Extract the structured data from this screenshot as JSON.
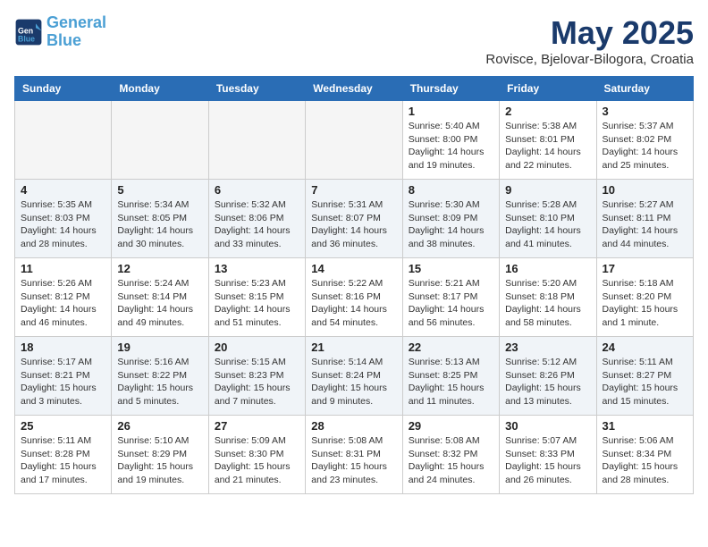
{
  "header": {
    "logo_line1": "General",
    "logo_line2": "Blue",
    "month": "May 2025",
    "location": "Rovisce, Bjelovar-Bilogora, Croatia"
  },
  "weekdays": [
    "Sunday",
    "Monday",
    "Tuesday",
    "Wednesday",
    "Thursday",
    "Friday",
    "Saturday"
  ],
  "weeks": [
    [
      {
        "day": "",
        "detail": ""
      },
      {
        "day": "",
        "detail": ""
      },
      {
        "day": "",
        "detail": ""
      },
      {
        "day": "",
        "detail": ""
      },
      {
        "day": "1",
        "detail": "Sunrise: 5:40 AM\nSunset: 8:00 PM\nDaylight: 14 hours\nand 19 minutes."
      },
      {
        "day": "2",
        "detail": "Sunrise: 5:38 AM\nSunset: 8:01 PM\nDaylight: 14 hours\nand 22 minutes."
      },
      {
        "day": "3",
        "detail": "Sunrise: 5:37 AM\nSunset: 8:02 PM\nDaylight: 14 hours\nand 25 minutes."
      }
    ],
    [
      {
        "day": "4",
        "detail": "Sunrise: 5:35 AM\nSunset: 8:03 PM\nDaylight: 14 hours\nand 28 minutes."
      },
      {
        "day": "5",
        "detail": "Sunrise: 5:34 AM\nSunset: 8:05 PM\nDaylight: 14 hours\nand 30 minutes."
      },
      {
        "day": "6",
        "detail": "Sunrise: 5:32 AM\nSunset: 8:06 PM\nDaylight: 14 hours\nand 33 minutes."
      },
      {
        "day": "7",
        "detail": "Sunrise: 5:31 AM\nSunset: 8:07 PM\nDaylight: 14 hours\nand 36 minutes."
      },
      {
        "day": "8",
        "detail": "Sunrise: 5:30 AM\nSunset: 8:09 PM\nDaylight: 14 hours\nand 38 minutes."
      },
      {
        "day": "9",
        "detail": "Sunrise: 5:28 AM\nSunset: 8:10 PM\nDaylight: 14 hours\nand 41 minutes."
      },
      {
        "day": "10",
        "detail": "Sunrise: 5:27 AM\nSunset: 8:11 PM\nDaylight: 14 hours\nand 44 minutes."
      }
    ],
    [
      {
        "day": "11",
        "detail": "Sunrise: 5:26 AM\nSunset: 8:12 PM\nDaylight: 14 hours\nand 46 minutes."
      },
      {
        "day": "12",
        "detail": "Sunrise: 5:24 AM\nSunset: 8:14 PM\nDaylight: 14 hours\nand 49 minutes."
      },
      {
        "day": "13",
        "detail": "Sunrise: 5:23 AM\nSunset: 8:15 PM\nDaylight: 14 hours\nand 51 minutes."
      },
      {
        "day": "14",
        "detail": "Sunrise: 5:22 AM\nSunset: 8:16 PM\nDaylight: 14 hours\nand 54 minutes."
      },
      {
        "day": "15",
        "detail": "Sunrise: 5:21 AM\nSunset: 8:17 PM\nDaylight: 14 hours\nand 56 minutes."
      },
      {
        "day": "16",
        "detail": "Sunrise: 5:20 AM\nSunset: 8:18 PM\nDaylight: 14 hours\nand 58 minutes."
      },
      {
        "day": "17",
        "detail": "Sunrise: 5:18 AM\nSunset: 8:20 PM\nDaylight: 15 hours\nand 1 minute."
      }
    ],
    [
      {
        "day": "18",
        "detail": "Sunrise: 5:17 AM\nSunset: 8:21 PM\nDaylight: 15 hours\nand 3 minutes."
      },
      {
        "day": "19",
        "detail": "Sunrise: 5:16 AM\nSunset: 8:22 PM\nDaylight: 15 hours\nand 5 minutes."
      },
      {
        "day": "20",
        "detail": "Sunrise: 5:15 AM\nSunset: 8:23 PM\nDaylight: 15 hours\nand 7 minutes."
      },
      {
        "day": "21",
        "detail": "Sunrise: 5:14 AM\nSunset: 8:24 PM\nDaylight: 15 hours\nand 9 minutes."
      },
      {
        "day": "22",
        "detail": "Sunrise: 5:13 AM\nSunset: 8:25 PM\nDaylight: 15 hours\nand 11 minutes."
      },
      {
        "day": "23",
        "detail": "Sunrise: 5:12 AM\nSunset: 8:26 PM\nDaylight: 15 hours\nand 13 minutes."
      },
      {
        "day": "24",
        "detail": "Sunrise: 5:11 AM\nSunset: 8:27 PM\nDaylight: 15 hours\nand 15 minutes."
      }
    ],
    [
      {
        "day": "25",
        "detail": "Sunrise: 5:11 AM\nSunset: 8:28 PM\nDaylight: 15 hours\nand 17 minutes."
      },
      {
        "day": "26",
        "detail": "Sunrise: 5:10 AM\nSunset: 8:29 PM\nDaylight: 15 hours\nand 19 minutes."
      },
      {
        "day": "27",
        "detail": "Sunrise: 5:09 AM\nSunset: 8:30 PM\nDaylight: 15 hours\nand 21 minutes."
      },
      {
        "day": "28",
        "detail": "Sunrise: 5:08 AM\nSunset: 8:31 PM\nDaylight: 15 hours\nand 23 minutes."
      },
      {
        "day": "29",
        "detail": "Sunrise: 5:08 AM\nSunset: 8:32 PM\nDaylight: 15 hours\nand 24 minutes."
      },
      {
        "day": "30",
        "detail": "Sunrise: 5:07 AM\nSunset: 8:33 PM\nDaylight: 15 hours\nand 26 minutes."
      },
      {
        "day": "31",
        "detail": "Sunrise: 5:06 AM\nSunset: 8:34 PM\nDaylight: 15 hours\nand 28 minutes."
      }
    ]
  ]
}
